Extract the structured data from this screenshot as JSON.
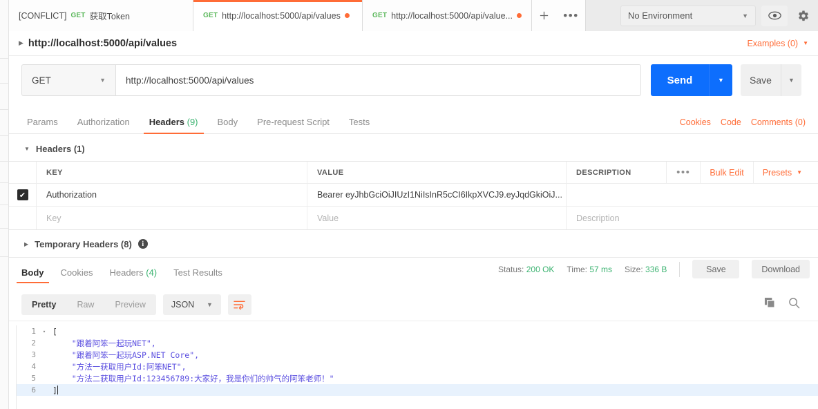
{
  "window": {
    "tabs": [
      {
        "prefix": "[CONFLICT]",
        "method": "GET",
        "title": "获取Token",
        "state": "inactive",
        "unsaved": false
      },
      {
        "prefix": "",
        "method": "GET",
        "title": "http://localhost:5000/api/values",
        "state": "active",
        "unsaved": true
      },
      {
        "prefix": "",
        "method": "GET",
        "title": "http://localhost:5000/api/value...",
        "state": "inactive",
        "unsaved": true
      }
    ],
    "new_tab_icon": "plus-icon",
    "tab_options_icon": "ellipsis-icon",
    "environment": "No Environment",
    "eye_icon": "eye-icon",
    "settings_icon": "gear-icon"
  },
  "request_header": {
    "name": "http://localhost:5000/api/values",
    "examples": "Examples (0)"
  },
  "request": {
    "method": "GET",
    "url": "http://localhost:5000/api/values",
    "send_label": "Send",
    "save_label": "Save"
  },
  "request_tabs": {
    "items": [
      {
        "label": "Params",
        "count": "",
        "active": false
      },
      {
        "label": "Authorization",
        "count": "",
        "active": false
      },
      {
        "label": "Headers",
        "count": "(9)",
        "active": true
      },
      {
        "label": "Body",
        "count": "",
        "active": false
      },
      {
        "label": "Pre-request Script",
        "count": "",
        "active": false
      },
      {
        "label": "Tests",
        "count": "",
        "active": false
      }
    ],
    "links": [
      "Cookies",
      "Code",
      "Comments (0)"
    ]
  },
  "headers_section": {
    "title": "Headers (1)",
    "columns": {
      "key": "KEY",
      "value": "VALUE",
      "description": "DESCRIPTION"
    },
    "tools": {
      "dots": "•••",
      "bulk_edit": "Bulk Edit",
      "presets": "Presets"
    },
    "rows": [
      {
        "checked": true,
        "key": "Authorization",
        "value": "Bearer eyJhbGciOiJIUzI1NiIsInR5cCI6IkpXVCJ9.eyJqdGkiOiJ...",
        "description": ""
      }
    ],
    "placeholder_row": {
      "key": "Key",
      "value": "Value",
      "description": "Description"
    },
    "temporary_headers": "Temporary Headers (8)"
  },
  "response": {
    "tabs": [
      {
        "label": "Body",
        "count": "",
        "active": true
      },
      {
        "label": "Cookies",
        "count": "",
        "active": false
      },
      {
        "label": "Headers",
        "count": "(4)",
        "active": false
      },
      {
        "label": "Test Results",
        "count": "",
        "active": false
      }
    ],
    "status_label": "Status:",
    "status_value": "200 OK",
    "time_label": "Time:",
    "time_value": "57 ms",
    "size_label": "Size:",
    "size_value": "336 B",
    "save_label": "Save",
    "download_label": "Download",
    "view_modes": [
      "Pretty",
      "Raw",
      "Preview"
    ],
    "active_view_mode": "Pretty",
    "format": "JSON",
    "wrap_icon": "word-wrap-icon",
    "copy_icon": "copy-icon",
    "search_icon": "search-icon",
    "body_lines": [
      {
        "no": "1",
        "fold": "▾",
        "text": "[",
        "punct": true,
        "highlight": false
      },
      {
        "no": "2",
        "fold": "",
        "text": "    \"跟着阿笨一起玩NET\",",
        "punct": false,
        "highlight": false
      },
      {
        "no": "3",
        "fold": "",
        "text": "    \"跟着阿笨一起玩ASP.NET Core\",",
        "punct": false,
        "highlight": false
      },
      {
        "no": "4",
        "fold": "",
        "text": "    \"方法一获取用户Id:阿笨NET\",",
        "punct": false,
        "highlight": false
      },
      {
        "no": "5",
        "fold": "",
        "text": "    \"方法二获取用户Id:123456789:大家好，我是你们的帅气的阿笨老师！\"",
        "punct": false,
        "highlight": false
      },
      {
        "no": "6",
        "fold": "",
        "text": "]",
        "punct": true,
        "highlight": true
      }
    ]
  },
  "colors": {
    "accent_orange": "#ff6c37",
    "send_blue": "#0d6efd",
    "status_green": "#3cb371",
    "json_string": "#5b4fe0",
    "active_line": "#e8f2fd"
  }
}
